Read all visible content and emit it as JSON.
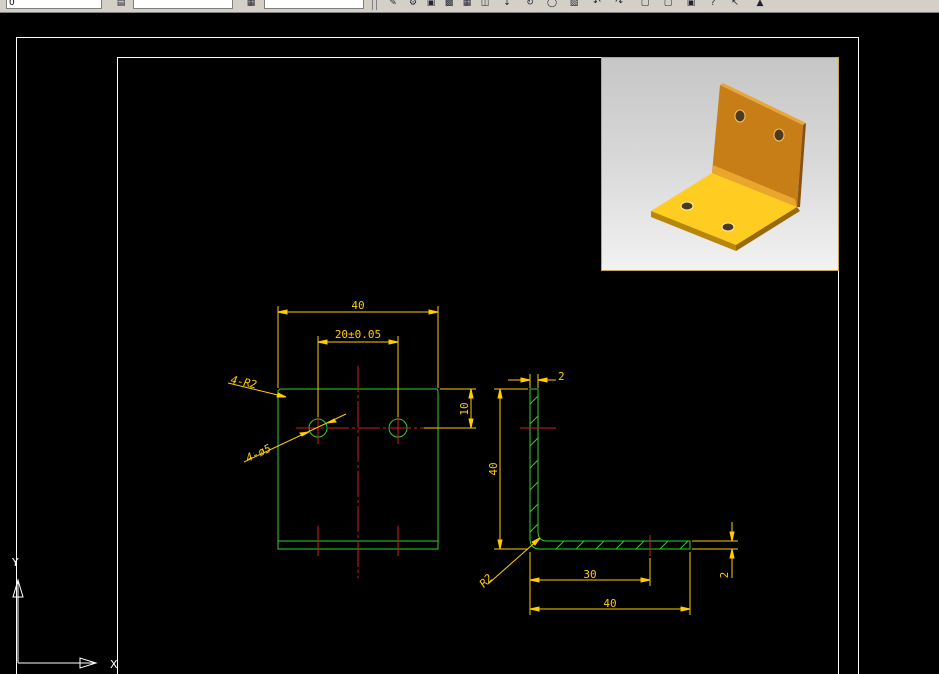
{
  "toolbar": {
    "layer_value": "0",
    "style_value": "",
    "dimstyle_value": "",
    "icons": [
      "layer-icon",
      "text-style-icon",
      "dim-style-icon",
      "pencil-icon",
      "gear-icon",
      "save-icon",
      "print-icon",
      "grid-icon",
      "arrow-down-icon",
      "refresh-icon",
      "distance-icon",
      "undo-icon",
      "window-icon",
      "window-icon",
      "pointer-icon",
      "paint-icon"
    ]
  },
  "drawing": {
    "front_view": {
      "dim_width": "40",
      "dim_hole_spacing": "20±0.05",
      "dim_hole_offset": "10",
      "label_corner_radius": "4-R2",
      "label_holes": "4-ø5"
    },
    "side_view": {
      "dim_thickness_top": "2",
      "dim_height": "40",
      "dim_inner_length": "30",
      "dim_total_length": "40",
      "dim_thickness_right": "2",
      "label_bend_radius": "R2"
    },
    "ucs": {
      "y_label": "Y",
      "x_label": "X"
    }
  },
  "colors": {
    "background": "#000000",
    "border": "#ffffff",
    "dimension": "#ffcc00",
    "outline": "#33cc33",
    "centerline": "#cc2020",
    "part": "#d9a426"
  }
}
